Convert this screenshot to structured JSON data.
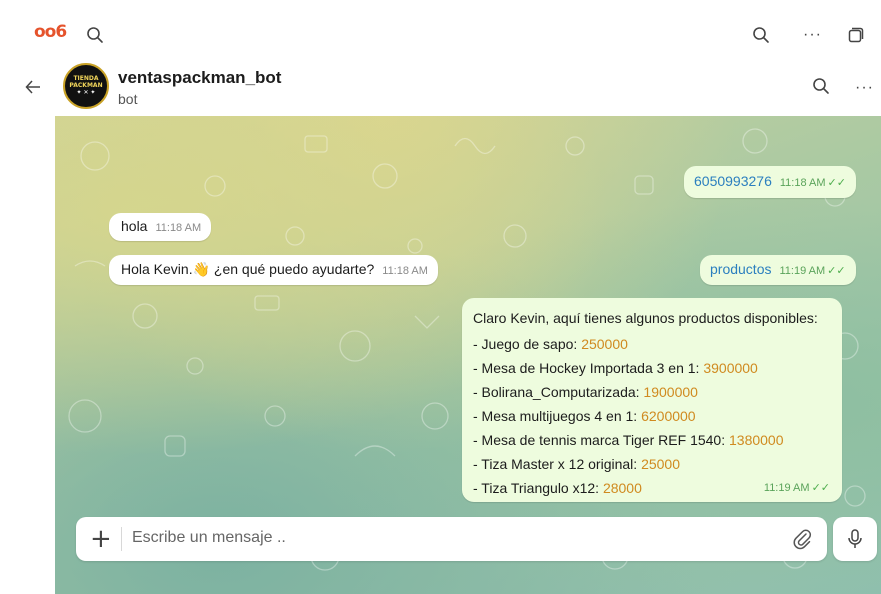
{
  "app": {
    "logo": "oo6",
    "icons": [
      "search-icon",
      "more-icon",
      "window-icon"
    ]
  },
  "chat_header": {
    "name": "ventaspackman_bot",
    "subtitle": "bot",
    "avatar_text": [
      "TIENDA",
      "PACKMAN",
      "✦ ✕ ✦"
    ]
  },
  "messages": [
    {
      "side": "out",
      "text": "6050993276",
      "time": "11:18 AM",
      "ticks": "✓✓"
    },
    {
      "side": "in",
      "text": "hola",
      "time": "11:18 AM"
    },
    {
      "side": "in",
      "text": "Hola Kevin.👋 ¿en qué puedo ayudarte?",
      "time": "11:18 AM"
    },
    {
      "side": "out",
      "text": "productos",
      "time": "11:19 AM",
      "ticks": "✓✓"
    },
    {
      "side": "out",
      "intro": "Claro Kevin, aquí tienes algunos productos disponibles:",
      "items": [
        {
          "label": "- Juego de sapo: ",
          "value": "250000"
        },
        {
          "label": "- Mesa de Hockey Importada 3 en 1: ",
          "value": "3900000"
        },
        {
          "label": "- Bolirana_Computarizada: ",
          "value": "1900000"
        },
        {
          "label": "- Mesa multijuegos 4 en 1: ",
          "value": "6200000"
        },
        {
          "label": "- Mesa de tennis marca Tiger REF 1540: ",
          "value": "1380000"
        },
        {
          "label": "- Tiza Master x 12 original: ",
          "value": "25000"
        },
        {
          "label": "- Tiza Triangulo x12: ",
          "value": "28000"
        }
      ],
      "time": "11:19 AM",
      "ticks": "✓✓"
    }
  ],
  "composer": {
    "placeholder": "Escribe un mensaje .."
  },
  "colors": {
    "logo": "#e5532c",
    "outgoing_bubble": "#eefcde",
    "price": "#d08a1f",
    "ticks": "#4fae4e"
  }
}
